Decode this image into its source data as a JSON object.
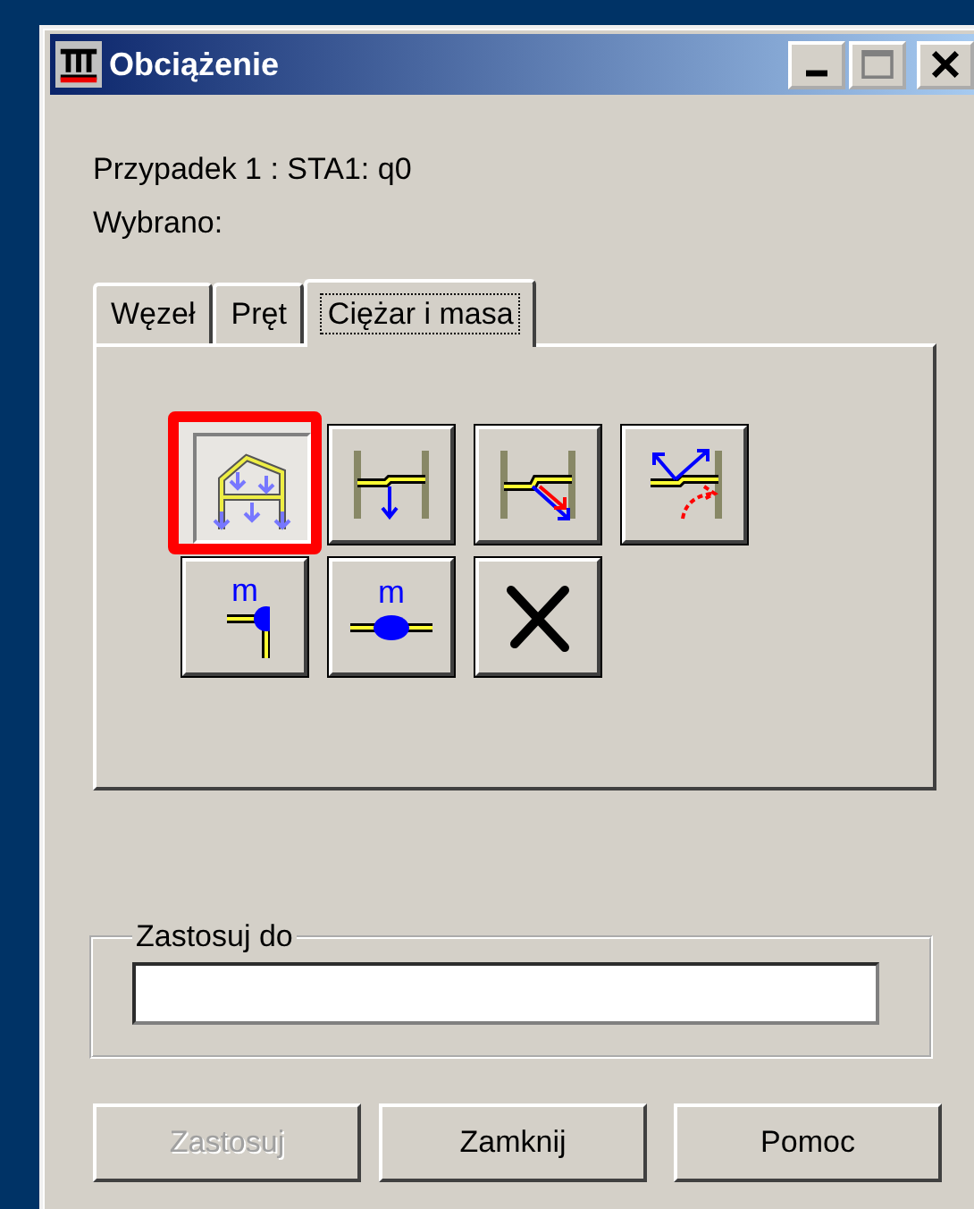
{
  "window": {
    "title": "Obciążenie"
  },
  "info": [
    "Przypadek 1 : STA1: q0",
    "Wybrano:"
  ],
  "tabs": [
    {
      "label": "Węzeł",
      "selected": false
    },
    {
      "label": "Pręt",
      "selected": false
    },
    {
      "label": "Ciężar i masa",
      "selected": true
    }
  ],
  "tools": [
    {
      "kind": "frame-load",
      "selected": true,
      "highlighted": true
    },
    {
      "kind": "beam-load",
      "selected": false,
      "highlighted": false
    },
    {
      "kind": "beam-inclined",
      "selected": false,
      "highlighted": false
    },
    {
      "kind": "beam-vectors",
      "selected": false,
      "highlighted": false
    },
    {
      "kind": "node-mass",
      "label": "m",
      "selected": false,
      "highlighted": false
    },
    {
      "kind": "beam-mass",
      "label": "m",
      "selected": false,
      "highlighted": false
    },
    {
      "kind": "delete",
      "selected": false,
      "highlighted": false
    }
  ],
  "apply_to": {
    "label": "Zastosuj do"
  },
  "buttons": [
    {
      "label": "Zastosuj",
      "disabled": true
    },
    {
      "label": "Zamknij",
      "disabled": false
    },
    {
      "label": "Pomoc",
      "disabled": false
    }
  ]
}
